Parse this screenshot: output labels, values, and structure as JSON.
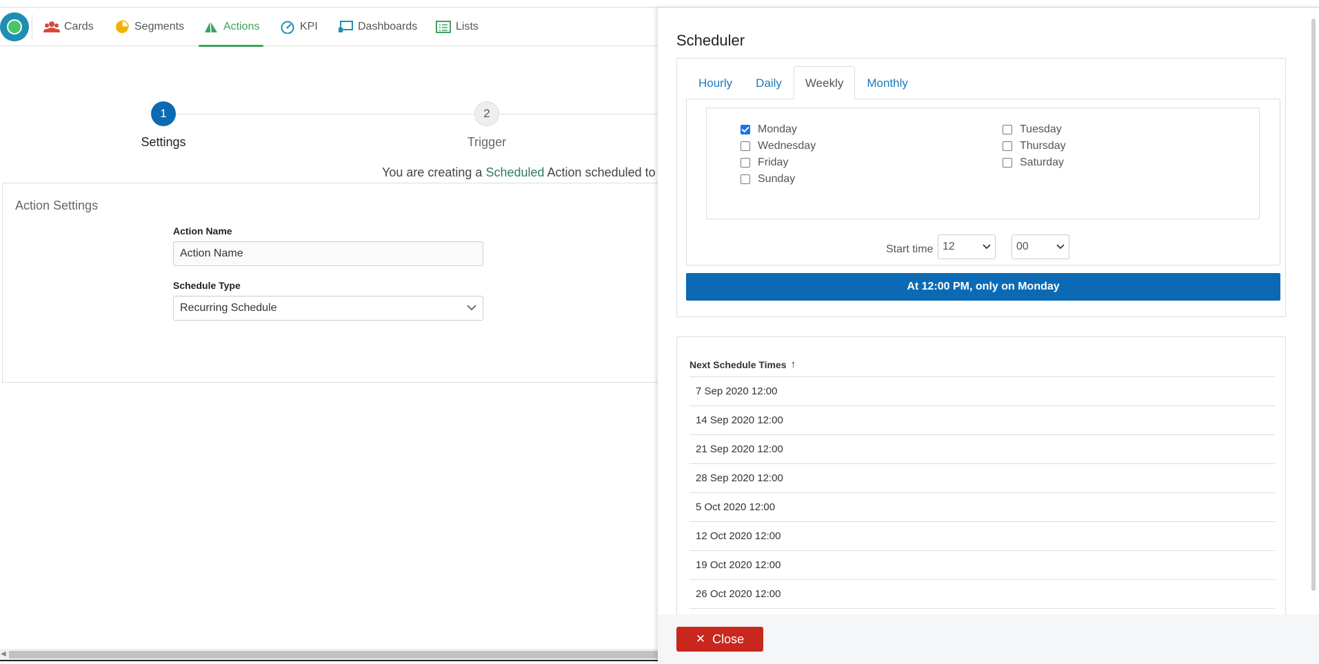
{
  "nav": {
    "items": [
      {
        "label": "Cards",
        "icon": "users-icon"
      },
      {
        "label": "Segments",
        "icon": "pie-chart-icon"
      },
      {
        "label": "Actions",
        "icon": "send-icon",
        "active": true
      },
      {
        "label": "KPI",
        "icon": "gauge-icon"
      },
      {
        "label": "Dashboards",
        "icon": "dashboard-icon"
      },
      {
        "label": "Lists",
        "icon": "list-icon"
      }
    ],
    "active_color": "#3aa35b"
  },
  "stepper": {
    "steps": [
      {
        "number": "1",
        "label": "Settings"
      },
      {
        "number": "2",
        "label": "Trigger"
      }
    ]
  },
  "info": {
    "prefix": "You are creating a ",
    "highlight": "Scheduled",
    "suffix": " Action scheduled to r"
  },
  "settings": {
    "title": "Action Settings",
    "action_name_label": "Action Name",
    "action_name_value": "Action Name",
    "schedule_type_label": "Schedule Type",
    "schedule_type_value": "Recurring Schedule"
  },
  "scheduler": {
    "title": "Scheduler",
    "tabs": [
      "Hourly",
      "Daily",
      "Weekly",
      "Monthly"
    ],
    "active_tab": "Weekly",
    "days": [
      {
        "label": "Monday",
        "checked": true
      },
      {
        "label": "Wednesday",
        "checked": false
      },
      {
        "label": "Friday",
        "checked": false
      },
      {
        "label": "Sunday",
        "checked": false
      },
      {
        "label": "Tuesday",
        "checked": false
      },
      {
        "label": "Thursday",
        "checked": false
      },
      {
        "label": "Saturday",
        "checked": false
      }
    ],
    "start_time_label": "Start time",
    "hour": "12",
    "minute": "00",
    "summary": "At 12:00 PM, only on Monday",
    "accent": "#0b6ab3"
  },
  "next_times": {
    "header": "Next Schedule Times",
    "rows": [
      "7 Sep 2020 12:00",
      "14 Sep 2020 12:00",
      "21 Sep 2020 12:00",
      "28 Sep 2020 12:00",
      "5 Oct 2020 12:00",
      "12 Oct 2020 12:00",
      "19 Oct 2020 12:00",
      "26 Oct 2020 12:00"
    ]
  },
  "footer": {
    "close_label": "Close",
    "close_color": "#c9271e"
  }
}
